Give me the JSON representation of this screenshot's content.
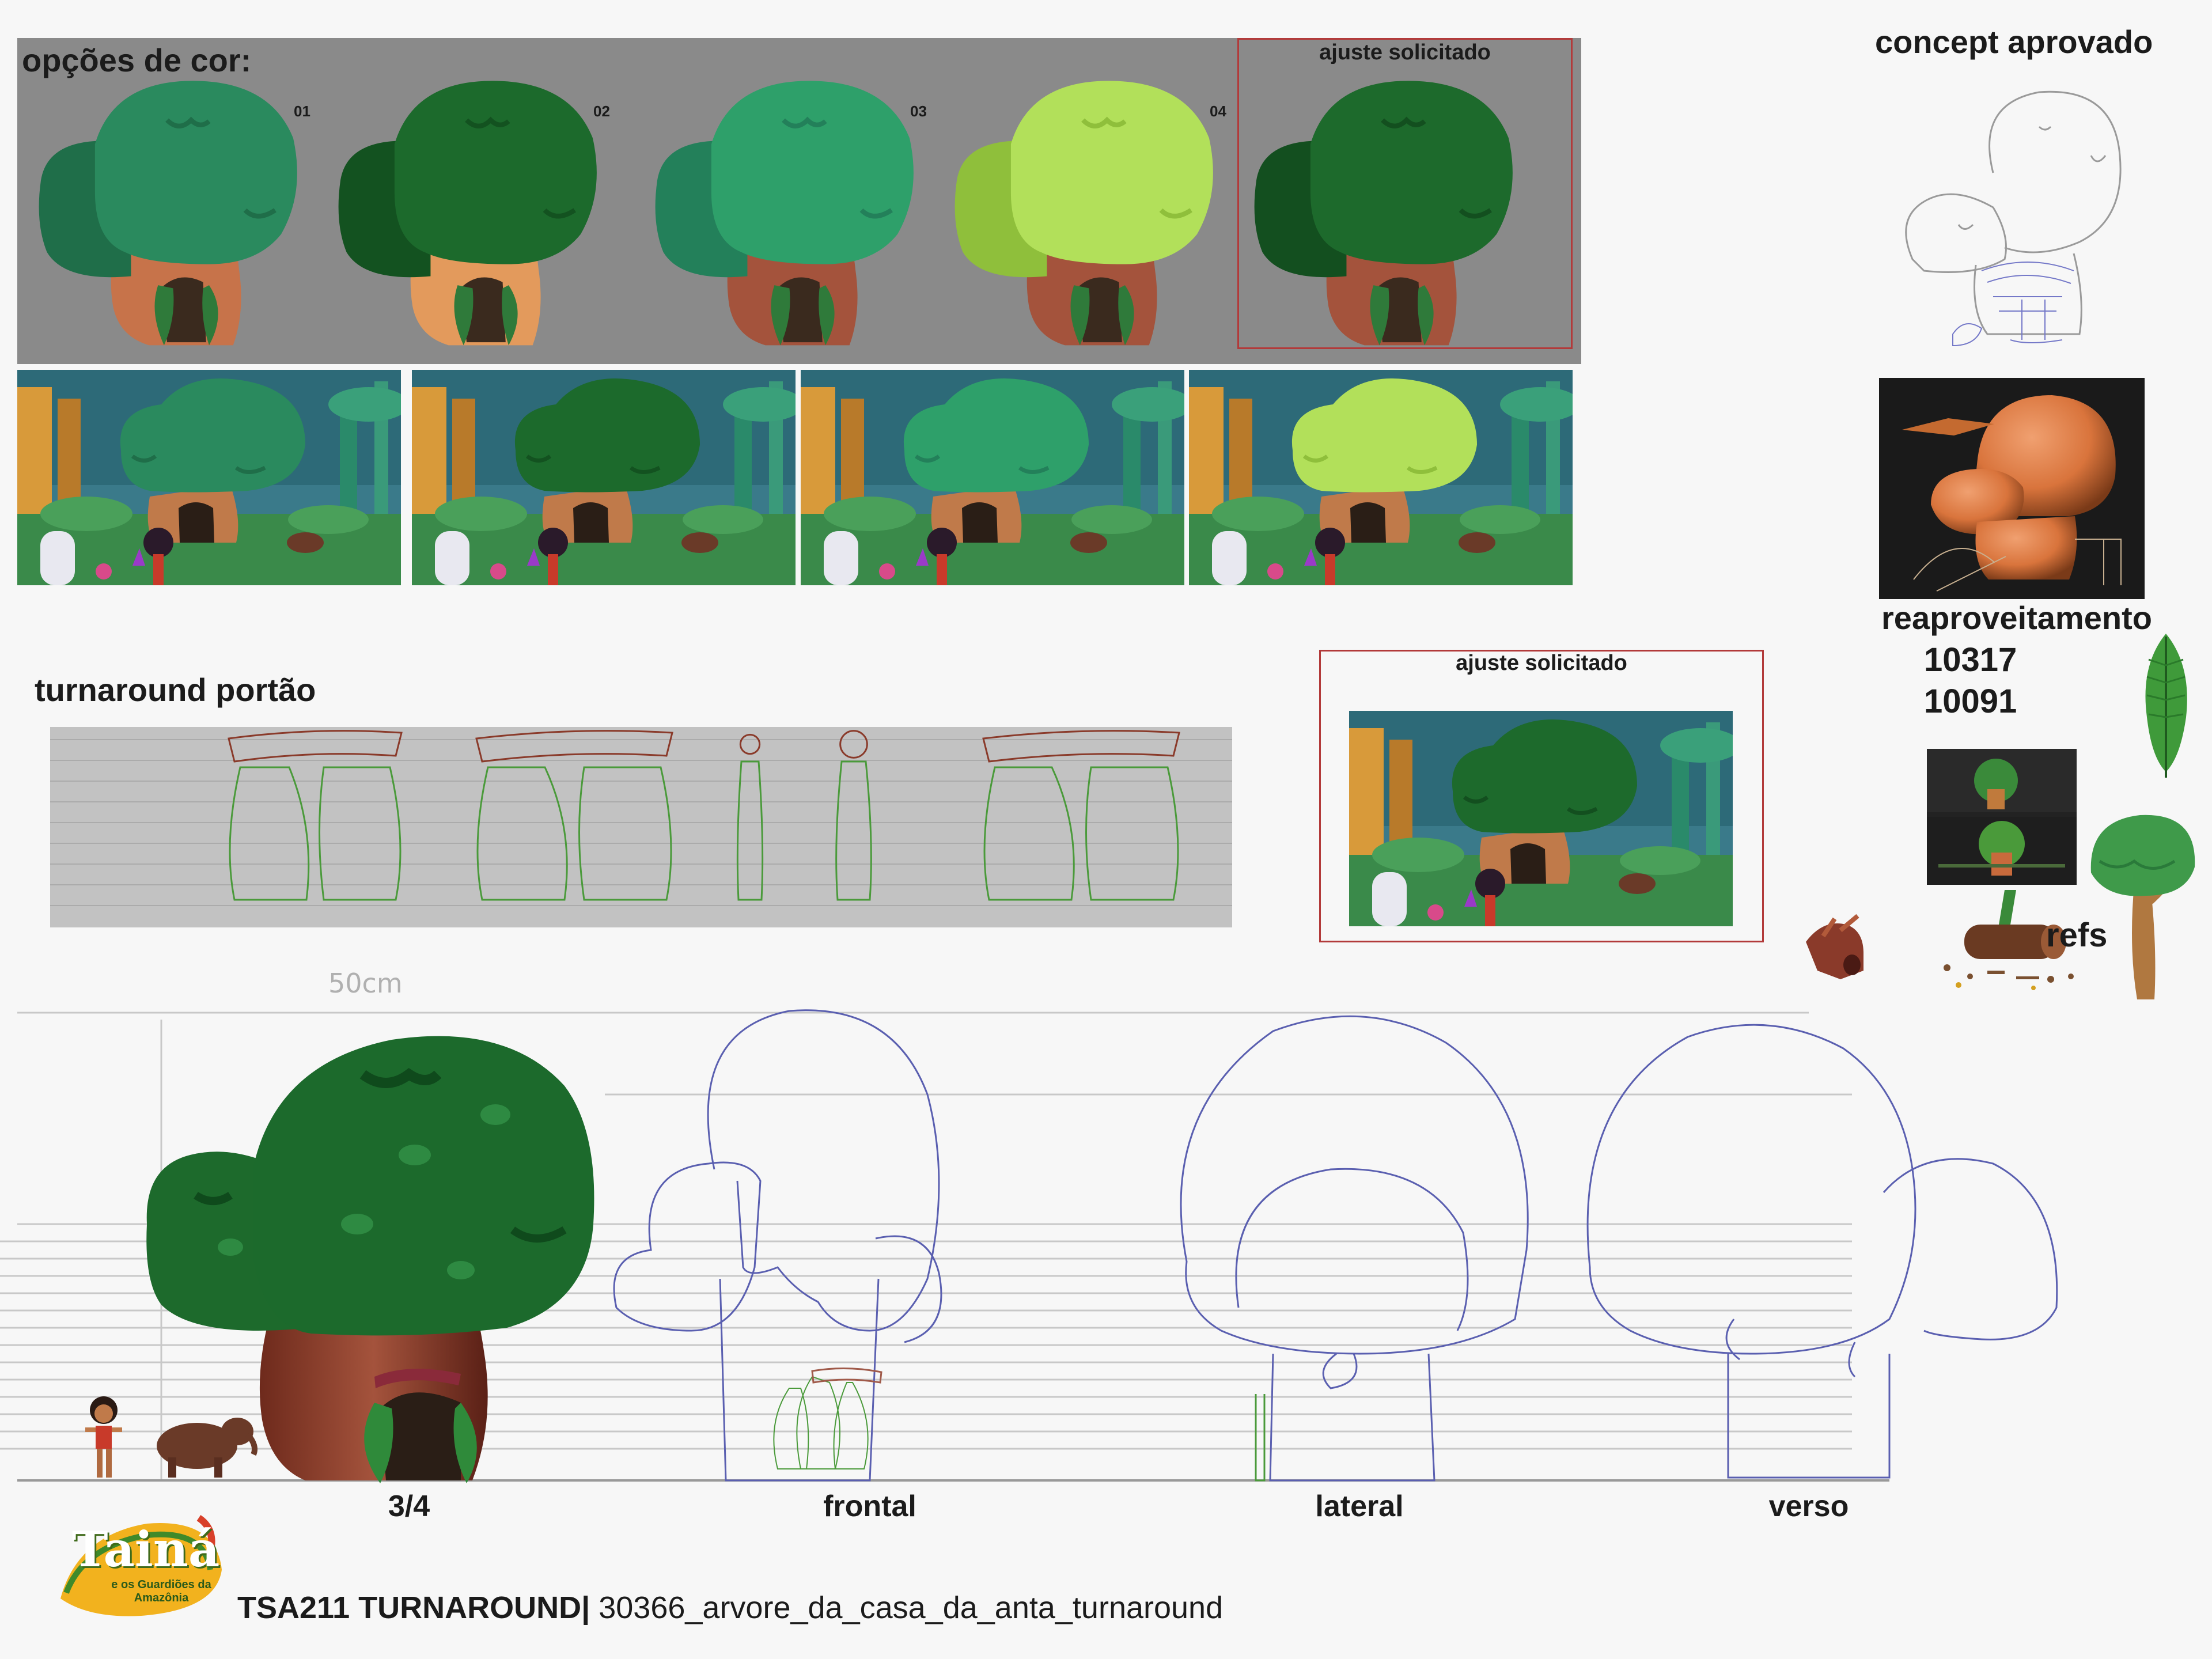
{
  "color_options": {
    "title": "opções de cor:",
    "variants": [
      {
        "number": "01",
        "canopy": "#2a8a5e",
        "canopy_shade": "#1f6e49",
        "trunk": "#c7734a"
      },
      {
        "number": "02",
        "canopy": "#1c6a2c",
        "canopy_shade": "#135220",
        "trunk": "#e39a5c"
      },
      {
        "number": "03",
        "canopy": "#2ea06a",
        "canopy_shade": "#23805a",
        "trunk": "#a4533c"
      },
      {
        "number": "04",
        "canopy": "#b2e05a",
        "canopy_shade": "#8fbf3b",
        "trunk": "#a4533c"
      },
      {
        "number": "",
        "canopy": "#1d6a2c",
        "canopy_shade": "#134f1f",
        "trunk": "#a4533c"
      }
    ],
    "ajuste_label": "ajuste solicitado"
  },
  "approved_concept": {
    "title": "concept aprovado"
  },
  "reuse": {
    "title": "reaproveitamento",
    "codes": [
      "10317",
      "10091"
    ]
  },
  "refs": {
    "label": "refs"
  },
  "gate_turnaround": {
    "title": "turnaround portão"
  },
  "adjustment": {
    "title": "ajuste solicitado"
  },
  "turnaround": {
    "scale_note": "50cm",
    "views": [
      "3/4",
      "frontal",
      "lateral",
      "verso"
    ]
  },
  "footer": {
    "logo_text": "Tainá",
    "logo_subtitle": "e os Guardiões da Amazônia",
    "code": "TSA211 TURNAROUND|",
    "filename": "30366_arvore_da_casa_da_anta_turnaround"
  },
  "colors": {
    "panel_grey": "#8a8a8a",
    "gate_panel": "#c2c2c2",
    "red_frame": "#b23a3a",
    "outline_blue": "#5a5fb0",
    "outline_green": "#4a9a3a",
    "sculpt_orange": "#d9743c"
  }
}
